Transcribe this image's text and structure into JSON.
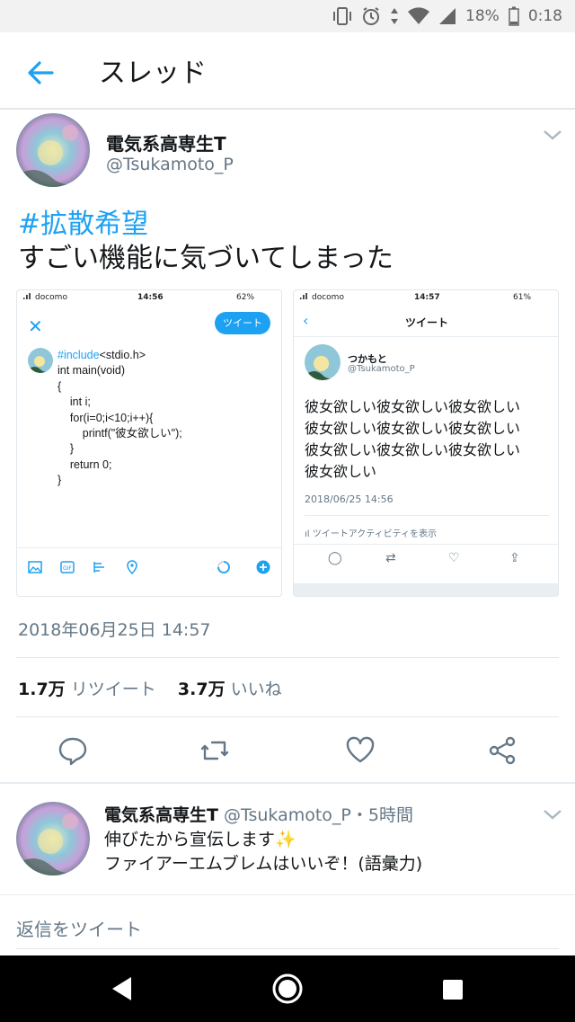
{
  "status_bar": {
    "battery": "18%",
    "time": "0:18"
  },
  "header": {
    "title": "スレッド"
  },
  "tweet": {
    "name": "電気系高専生T",
    "handle": "@Tsukamoto_P",
    "hashtag": "#拡散希望",
    "text": "すごい機能に気づいてしまった",
    "timestamp": "2018年06月25日 14:57",
    "retweets_count": "1.7万",
    "retweets_label": "リツイート",
    "likes_count": "3.7万",
    "likes_label": "いいね"
  },
  "screenshot1": {
    "carrier": "docomo",
    "time": "14:56",
    "battery": "62%",
    "tweet_button": "ツイート",
    "code": {
      "include_kw": "#include",
      "include_rest": "<stdio.h>",
      "lines": [
        "int main(void)",
        "{",
        "    int i;",
        "    for(i=0;i<10;i++){",
        "        printf(\"彼女欲しい\");",
        "    }",
        "    return 0;",
        "}"
      ]
    }
  },
  "screenshot2": {
    "carrier": "docomo",
    "time": "14:57",
    "battery": "61%",
    "title": "ツイート",
    "name": "つかもと",
    "handle": "@Tsukamoto_P",
    "body_lines": [
      "彼女欲しい彼女欲しい彼女欲しい",
      "彼女欲しい彼女欲しい彼女欲しい",
      "彼女欲しい彼女欲しい彼女欲しい",
      "彼女欲しい"
    ],
    "date": "2018/06/25 14:56",
    "activity": "ツイートアクティビティを表示"
  },
  "reply": {
    "name": "電気系高専生T",
    "handle": "@Tsukamoto_P",
    "time": "・5時間",
    "line1": "伸びたから宣伝します",
    "line2": "ファイアーエムブレムはいいぞ！(語彙力)"
  },
  "reply_box": {
    "placeholder": "返信をツイート"
  },
  "colors": {
    "accent": "#1da1f2",
    "muted": "#657786",
    "text": "#14171a"
  },
  "icons": [
    "back-arrow-icon",
    "chevron-down-icon",
    "reply-icon",
    "retweet-icon",
    "like-icon",
    "share-icon",
    "sparkle-icon",
    "nav-back-icon",
    "nav-home-icon",
    "nav-recents-icon"
  ]
}
